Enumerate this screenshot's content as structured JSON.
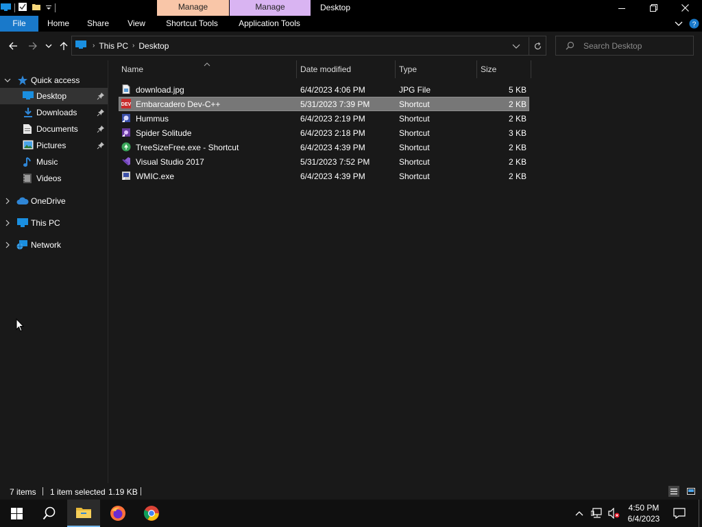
{
  "window": {
    "title": "Desktop",
    "context_tab_shortcut": "Manage",
    "context_tab_app": "Manage"
  },
  "ribbon": {
    "tabs": [
      "File",
      "Home",
      "Share",
      "View",
      "Shortcut Tools",
      "Application Tools"
    ]
  },
  "address": {
    "crumbs": [
      "This PC",
      "Desktop"
    ]
  },
  "search": {
    "placeholder": "Search Desktop"
  },
  "nav": {
    "quick_access": "Quick access",
    "items": [
      {
        "label": "Desktop",
        "icon": "desktop-icon",
        "pinned": true
      },
      {
        "label": "Downloads",
        "icon": "downloads-icon",
        "pinned": true
      },
      {
        "label": "Documents",
        "icon": "documents-icon",
        "pinned": true
      },
      {
        "label": "Pictures",
        "icon": "pictures-icon",
        "pinned": true
      },
      {
        "label": "Music",
        "icon": "music-icon",
        "pinned": false
      },
      {
        "label": "Videos",
        "icon": "videos-icon",
        "pinned": false
      }
    ],
    "onedrive": "OneDrive",
    "this_pc": "This PC",
    "network": "Network"
  },
  "columns": {
    "name": "Name",
    "date": "Date modified",
    "type": "Type",
    "size": "Size"
  },
  "files": [
    {
      "name": "download.jpg",
      "date": "6/4/2023 4:06 PM",
      "type": "JPG File",
      "size": "5 KB",
      "icon": "jpg-file-icon",
      "selected": false
    },
    {
      "name": "Embarcadero Dev-C++",
      "date": "5/31/2023 7:39 PM",
      "type": "Shortcut",
      "size": "2 KB",
      "icon": "devcpp-icon",
      "selected": true
    },
    {
      "name": "Hummus",
      "date": "6/4/2023 2:19 PM",
      "type": "Shortcut",
      "size": "2 KB",
      "icon": "hummus-icon",
      "selected": false
    },
    {
      "name": "Spider Solitude",
      "date": "6/4/2023 2:18 PM",
      "type": "Shortcut",
      "size": "3 KB",
      "icon": "spider-solitude-icon",
      "selected": false
    },
    {
      "name": "TreeSizeFree.exe - Shortcut",
      "date": "6/4/2023 4:39 PM",
      "type": "Shortcut",
      "size": "2 KB",
      "icon": "treesize-icon",
      "selected": false
    },
    {
      "name": "Visual Studio 2017",
      "date": "5/31/2023 7:52 PM",
      "type": "Shortcut",
      "size": "2 KB",
      "icon": "visual-studio-icon",
      "selected": false
    },
    {
      "name": "WMIC.exe",
      "date": "6/4/2023 4:39 PM",
      "type": "Shortcut",
      "size": "2 KB",
      "icon": "wmic-icon",
      "selected": false
    }
  ],
  "status": {
    "items": "7 items",
    "selected": "1 item selected",
    "size": "1.19 KB"
  },
  "taskbar": {
    "time": "4:50 PM",
    "date": "6/4/2023"
  },
  "colors": {
    "accent": "#1979ca",
    "shortcut_tools": "#f9c6a8",
    "application_tools": "#d9b4f2"
  }
}
